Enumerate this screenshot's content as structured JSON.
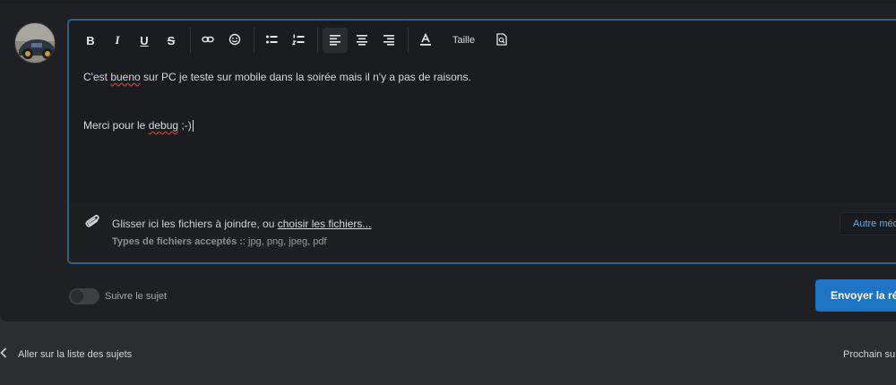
{
  "toolbar": {
    "bold_label": "B",
    "italic_label": "I",
    "underline_label": "U",
    "strike_label": "S",
    "size_label": "Taille"
  },
  "editor": {
    "line1_a": "C'est ",
    "line1_spell": "bueno",
    "line1_b": " sur PC je teste sur mobile dans la soirée mais il n'y a pas de raisons.",
    "line2_a": "Merci pour le ",
    "line2_spell": "debug",
    "line2_b": " ;-)"
  },
  "attachments": {
    "drop_text": "Glisser ici les fichiers à joindre, ou ",
    "choose_link": "choisir les fichiers...",
    "types_label": "Types de fichiers acceptés :",
    "types_value": ": jpg, png, jpeg, pdf",
    "other_media": "Autre méd"
  },
  "follow": {
    "label": "Suivre le sujet",
    "enabled": false
  },
  "send_label": "Envoyer la rép",
  "nav": {
    "back_label": "Aller sur la liste des sujets",
    "next_label": "Prochain su"
  },
  "colors": {
    "accent": "#1f74c4",
    "editor_border": "#2e5f86",
    "panel": "#1f2023",
    "background": "#2b2d31",
    "spellcheck": "#d9382e"
  },
  "icons": [
    "link-icon",
    "emoji-icon",
    "bullet-list-icon",
    "numbered-list-icon",
    "align-left-icon",
    "align-center-icon",
    "align-right-icon",
    "text-color-icon",
    "preview-icon",
    "paperclip-icon",
    "chevron-left-icon"
  ]
}
